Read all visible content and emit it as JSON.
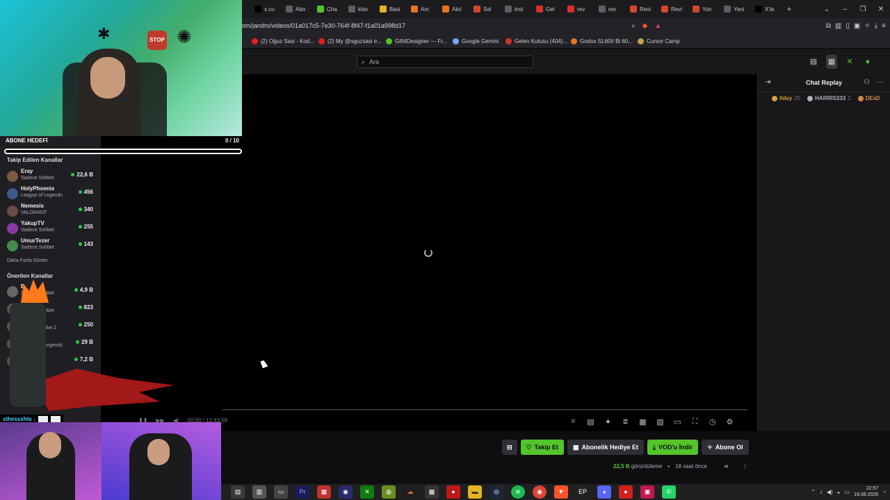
{
  "browser": {
    "tabs": [
      {
        "label": "x.co",
        "icon": "x-icon",
        "color": "#000000"
      },
      {
        "label": "Abo",
        "icon": "generic-icon",
        "color": "#5e5e66"
      },
      {
        "label": "Cha",
        "icon": "kick-icon",
        "color": "#53c42a"
      },
      {
        "label": "klav",
        "icon": "generic-icon",
        "color": "#5e5e66"
      },
      {
        "label": "Basi",
        "icon": "doc-icon",
        "color": "#e6b422"
      },
      {
        "label": "Am",
        "icon": "amazon-icon",
        "color": "#e8741e"
      },
      {
        "label": "Akri",
        "icon": "amazon-icon",
        "color": "#e8741e"
      },
      {
        "label": "Sel",
        "icon": "generic-icon",
        "color": "#d04a2a"
      },
      {
        "label": "inst",
        "icon": "generic-icon",
        "color": "#5e5e66"
      },
      {
        "label": "Gel",
        "icon": "gmail-icon",
        "color": "#d93025"
      },
      {
        "label": "rev",
        "icon": "shield-icon",
        "color": "#d93025"
      },
      {
        "label": "rev",
        "icon": "generic-icon",
        "color": "#5e5e66"
      },
      {
        "label": "Revi",
        "icon": "generic-icon",
        "color": "#d04a2a"
      },
      {
        "label": "Revi",
        "icon": "generic-icon",
        "color": "#d04a2a"
      },
      {
        "label": "Yon",
        "icon": "generic-icon",
        "color": "#d04a2a"
      },
      {
        "label": "Yeni",
        "icon": "shield-icon",
        "color": "#5e5e66"
      },
      {
        "label": "X'te",
        "icon": "x-icon",
        "color": "#000000"
      }
    ],
    "url": "om/jandro/videos/01a017c5-7e30-764f-8f47-f1a01a998d17",
    "bookmarks": [
      {
        "label": "(2) Oğuz Sasi - Kod...",
        "color": "#e02020"
      },
      {
        "label": "(2) My @oguzsasi e...",
        "color": "#e02020"
      },
      {
        "label": "Gift4Designer — Fr...",
        "color": "#53c42a"
      },
      {
        "label": "Google Gemini",
        "color": "#7aa3ff"
      },
      {
        "label": "Gelen Kutusu (404)...",
        "color": "#d93025"
      },
      {
        "label": "Godox SL60II Bi 60...",
        "color": "#e8741e"
      },
      {
        "label": "Cursor Camp",
        "color": "#c8a24a"
      }
    ]
  },
  "topnav": {
    "search_placeholder": "Ara"
  },
  "sub_goal": {
    "label": "ABONE HEDEFİ",
    "count": "0 / 10",
    "progress": 0
  },
  "sidebar": {
    "followed_title": "Takip Edilen Kanallar",
    "followed": [
      {
        "name": "Eray",
        "game": "Sadece Sohbet",
        "viewers": "22,6 B",
        "color": "#7a5a40"
      },
      {
        "name": "HolyPhoenix",
        "game": "League of Legends",
        "viewers": "456",
        "color": "#3d5a8a"
      },
      {
        "name": "Nemesis",
        "game": "VALORANT",
        "viewers": "340",
        "color": "#6a4a4a"
      },
      {
        "name": "YakupTV",
        "game": "Sadece Sohbet",
        "viewers": "255",
        "color": "#8a3aa8"
      },
      {
        "name": "UmurTezer",
        "game": "Sadece Sohbet",
        "viewers": "143",
        "color": "#4a8a4a"
      }
    ],
    "show_more": "Daha Fazla Göster",
    "recommended_title": "Önerilen Kanallar",
    "recommended": [
      {
        "name": "B",
        "game": "Sadece Sohbet",
        "viewers": "4,9 B",
        "color": "#666666"
      },
      {
        "name": "",
        "game": "Sadece Sohbet",
        "viewers": "823",
        "color": "#555555"
      },
      {
        "name": "entv",
        "game": "Counter-Strike 2",
        "viewers": "250",
        "color": "#555555"
      },
      {
        "name": "R",
        "game": "League of Legends",
        "viewers": "29 B",
        "color": "#555555"
      },
      {
        "name": "",
        "game": "",
        "viewers": "7,2 B",
        "color": "#555555"
      }
    ]
  },
  "player": {
    "time": "00:00 / 12:43:59"
  },
  "chat": {
    "title": "Chat Replay",
    "leaderboard": [
      {
        "name": "lldsy",
        "count": "25",
        "color": "#d8a23a"
      },
      {
        "name": "HARRIS333",
        "count": "2",
        "color": "#b0b0b8"
      },
      {
        "name": "DEaD",
        "count": "",
        "color": "#d08a4a"
      }
    ]
  },
  "overlay_chat": {
    "user": "xthesxxhte :"
  },
  "actions": {
    "follow": "Takip Et",
    "gift_sub": "Abonelik Hediye Et",
    "download_vod": "VOD'u İndir",
    "subscribe": "Abone Ol"
  },
  "stats": {
    "views": "22,5 B",
    "views_label": "görüntüleme",
    "age": "18 saat önce"
  },
  "taskbar": {
    "time": "22:57",
    "date": "19.08.2026",
    "accent": "#53c42a"
  }
}
